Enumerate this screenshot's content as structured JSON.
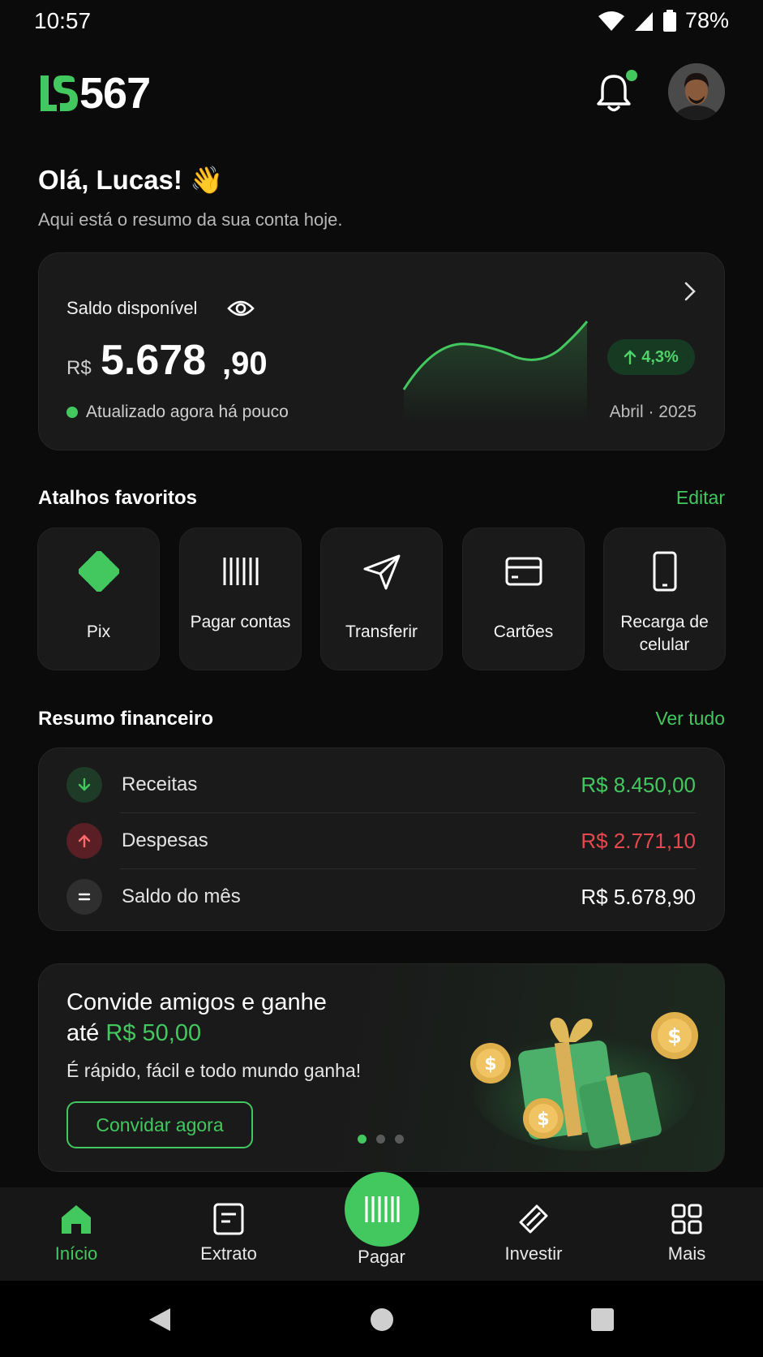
{
  "status": {
    "time": "10:57",
    "battery": "78%"
  },
  "header": {
    "brand": "567"
  },
  "greeting": {
    "title": "Olá, Lucas! 👋",
    "subtitle": "Aqui está o resumo da sua conta hoje."
  },
  "balance": {
    "label": "Saldo disponível",
    "currency": "R$",
    "amount_main": "5.678",
    "amount_cents": ",90",
    "updated": "Atualizado agora há pouco",
    "change": "4,3%",
    "period": "Abril · 2025"
  },
  "shortcuts": {
    "title": "Atalhos favoritos",
    "edit": "Editar",
    "items": [
      {
        "label": "Pix"
      },
      {
        "label": "Pagar contas"
      },
      {
        "label": "Transferir"
      },
      {
        "label": "Cartões"
      },
      {
        "label": "Recarga de celular"
      }
    ]
  },
  "summary": {
    "title": "Resumo financeiro",
    "link": "Ver tudo",
    "rows": [
      {
        "label": "Receitas",
        "value": "R$ 8.450,00"
      },
      {
        "label": "Despesas",
        "value": "R$ 2.771,10"
      },
      {
        "label": "Saldo do mês",
        "value": "R$ 5.678,90"
      }
    ]
  },
  "promo": {
    "title_line1": "Convide amigos e ganhe",
    "title_prefix": "até ",
    "title_highlight": "R$ 50,00",
    "subtitle": "É rápido, fácil e todo mundo ganha!",
    "button": "Convidar agora",
    "coin_symbol": "$"
  },
  "nav": {
    "items": [
      {
        "label": "Início"
      },
      {
        "label": "Extrato"
      },
      {
        "label": "Pagar"
      },
      {
        "label": "Investir"
      },
      {
        "label": "Mais"
      }
    ]
  },
  "colors": {
    "accent": "#43c85f",
    "expense": "#e5484d",
    "background": "#0b0b0b",
    "card": "#1a1a1a"
  }
}
